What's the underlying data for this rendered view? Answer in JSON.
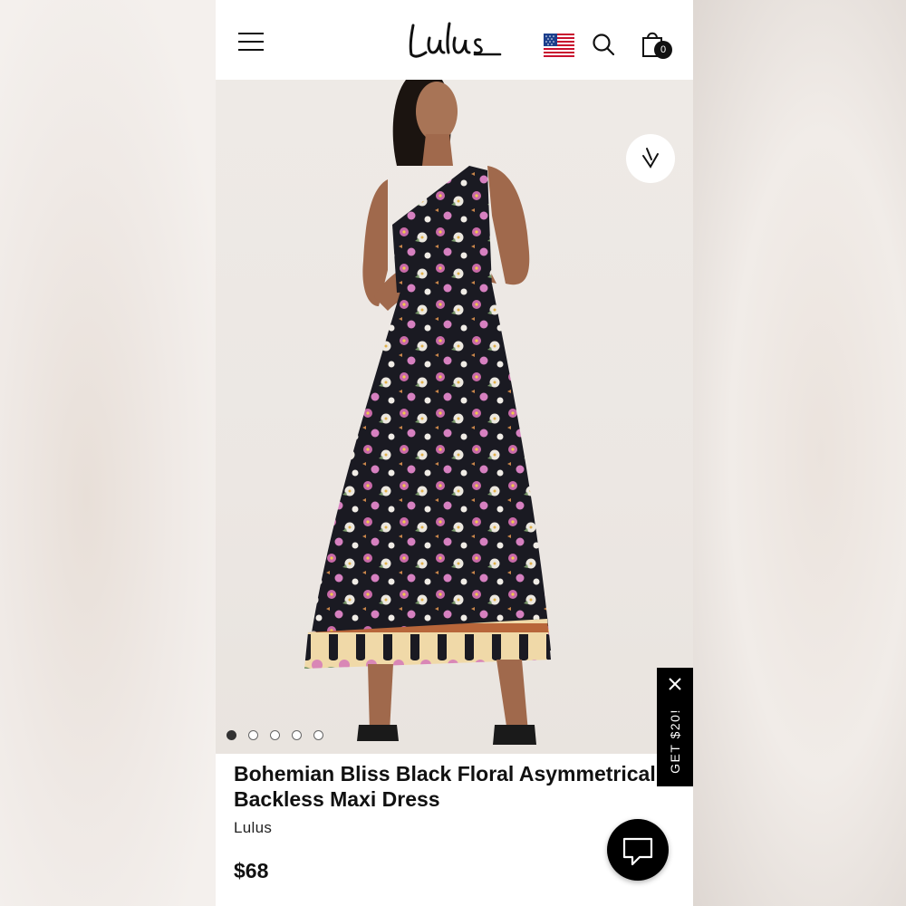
{
  "header": {
    "logo_text": "Lulus",
    "cart_count": "0"
  },
  "gallery": {
    "dot_count": 5,
    "active_index": 0
  },
  "promo": {
    "label": "GET $20!"
  },
  "product": {
    "title": "Bohemian Bliss Black Floral Asymmetrical Backless Maxi Dress",
    "brand": "Lulus",
    "price": "$68"
  },
  "colors": {
    "accent": "#000000",
    "background": "#ffffff"
  }
}
